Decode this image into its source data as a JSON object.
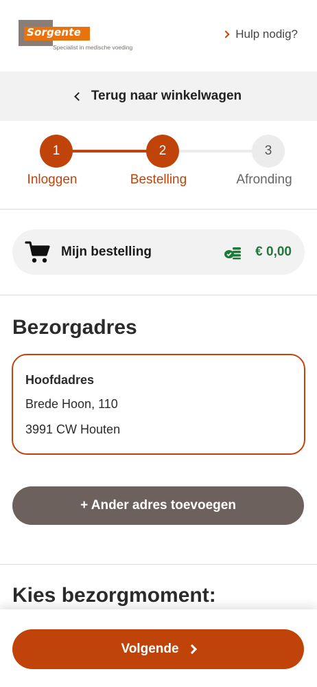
{
  "header": {
    "logo_text": "Sorgente",
    "logo_tagline": "Specialist in medische voeding",
    "help_label": "Hulp nodig?"
  },
  "backbar": {
    "label": "Terug naar winkelwagen"
  },
  "steps": [
    {
      "number": "1",
      "label": "Inloggen",
      "state": "done"
    },
    {
      "number": "2",
      "label": "Bestelling",
      "state": "current"
    },
    {
      "number": "3",
      "label": "Afronding",
      "state": "todo"
    }
  ],
  "order": {
    "label": "Mijn bestelling",
    "price": "€ 0,00"
  },
  "delivery": {
    "title": "Bezorgadres",
    "address": {
      "name": "Hoofdadres",
      "street": "Brede Hoon, 110",
      "city": "3991 CW Houten"
    },
    "add_button": "+ Ander adres toevoegen"
  },
  "moment": {
    "title": "Kies bezorgmoment:"
  },
  "footer": {
    "next_label": "Volgende"
  },
  "colors": {
    "accent": "#c0440a",
    "price_green": "#1e7a3a",
    "secondary_button": "#6d615d"
  },
  "icons": [
    "chevron-right-icon",
    "chevron-left-icon",
    "cart-icon",
    "coins-icon"
  ]
}
